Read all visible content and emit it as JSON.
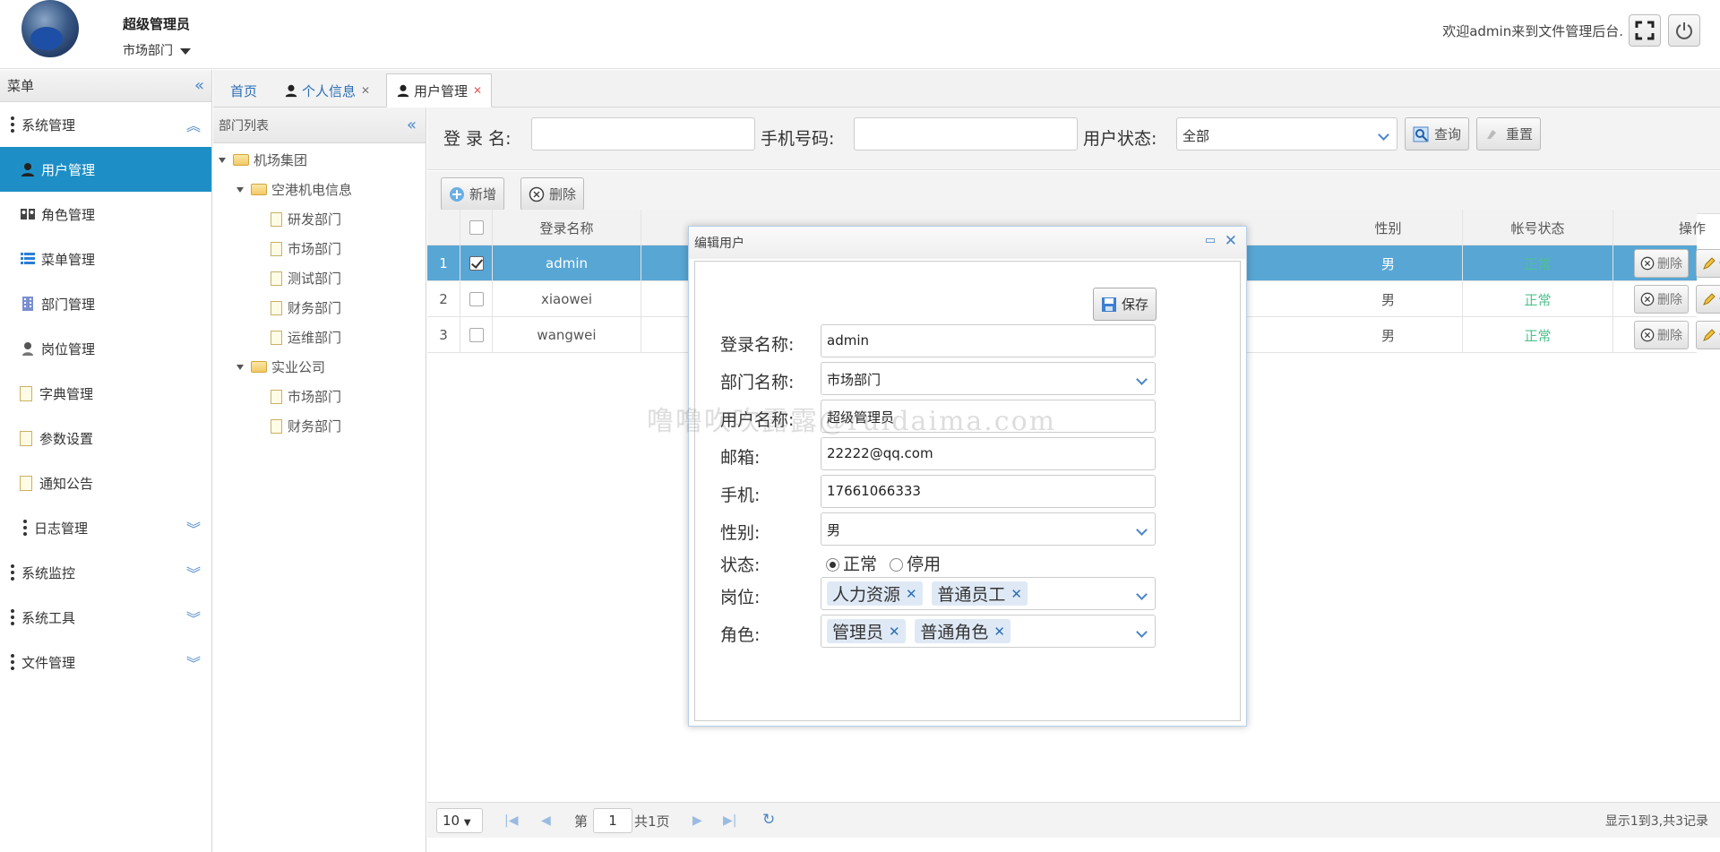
{
  "header": {
    "user_name": "超级管理员",
    "dept": "市场部门",
    "welcome": "欢迎admin来到文件管理后台."
  },
  "sidebar": {
    "title": "菜单",
    "groups": [
      {
        "label": "系统管理"
      },
      {
        "label": "日志管理"
      },
      {
        "label": "系统监控"
      },
      {
        "label": "系统工具"
      },
      {
        "label": "文件管理"
      }
    ],
    "items": [
      {
        "label": "用户管理"
      },
      {
        "label": "角色管理"
      },
      {
        "label": "菜单管理"
      },
      {
        "label": "部门管理"
      },
      {
        "label": "岗位管理"
      },
      {
        "label": "字典管理"
      },
      {
        "label": "参数设置"
      },
      {
        "label": "通知公告"
      }
    ]
  },
  "tabs": [
    {
      "label": "首页"
    },
    {
      "label": "个人信息"
    },
    {
      "label": "用户管理"
    }
  ],
  "dept_panel": {
    "title": "部门列表",
    "nodes": [
      {
        "label": "机场集团"
      },
      {
        "label": "空港机电信息"
      },
      {
        "label": "研发部门"
      },
      {
        "label": "市场部门"
      },
      {
        "label": "测试部门"
      },
      {
        "label": "财务部门"
      },
      {
        "label": "运维部门"
      },
      {
        "label": "实业公司"
      },
      {
        "label": "市场部门"
      },
      {
        "label": "财务部门"
      }
    ]
  },
  "search": {
    "login_label": "登 录 名:",
    "phone_label": "手机号码:",
    "status_label": "用户状态:",
    "status_value": "全部",
    "query": "查询",
    "reset": "重置"
  },
  "toolbar": {
    "add": "新增",
    "delete": "删除"
  },
  "grid": {
    "columns": [
      "登录名称",
      "性别",
      "帐号状态",
      "操作"
    ],
    "rows": [
      {
        "no": "1",
        "login": "admin",
        "gender": "男",
        "status": "正常"
      },
      {
        "no": "2",
        "login": "xiaowei",
        "gender": "男",
        "status": "正常"
      },
      {
        "no": "3",
        "login": "wangwei",
        "gender": "男",
        "status": "正常"
      }
    ],
    "op_delete": "删除",
    "op_edit": "修改"
  },
  "pager": {
    "size": "10",
    "page_prefix": "第",
    "page": "1",
    "page_suffix": "共1页",
    "summary": "显示1到3,共3记录"
  },
  "dialog": {
    "title": "编辑用户",
    "save": "保存",
    "login_label": "登录名称:",
    "login_value": "admin",
    "dept_label": "部门名称:",
    "dept_value": "市场部门",
    "username_label": "用户名称:",
    "username_value": "超级管理员",
    "email_label": "邮箱:",
    "email_value": "22222@qq.com",
    "phone_label": "手机:",
    "phone_value": "17661066333",
    "gender_label": "性别:",
    "gender_value": "男",
    "status_label": "状态:",
    "status_normal": "正常",
    "status_disabled": "停用",
    "post_label": "岗位:",
    "posts": [
      "人力资源",
      "普通员工"
    ],
    "role_label": "角色:",
    "roles": [
      "管理员",
      "普通角色"
    ]
  },
  "watermark": "噜噜吹吹露露@ruidaima.com"
}
